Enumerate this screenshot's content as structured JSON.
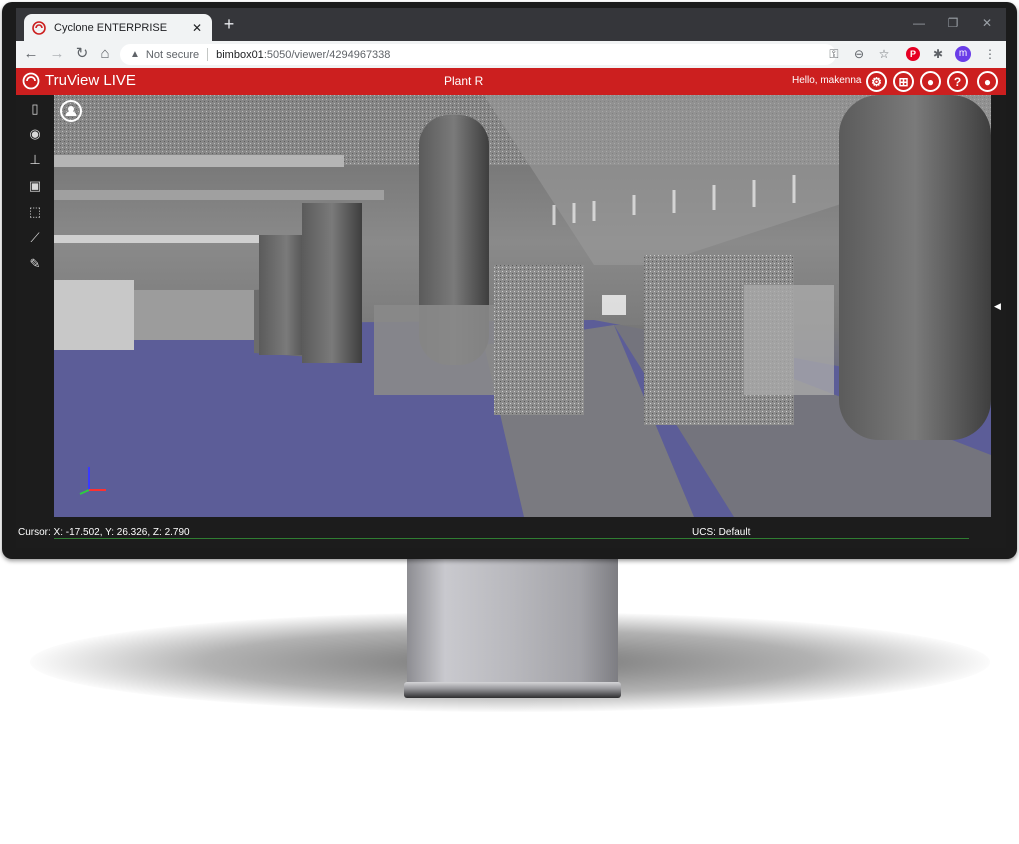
{
  "browser": {
    "tab_title": "Cyclone ENTERPRISE",
    "tab_close": "✕",
    "new_tab": "+",
    "window_controls": [
      "—",
      "❐",
      "✕"
    ],
    "security_label": "Not secure",
    "url_host": "bimbox01",
    "url_path": ":5050/viewer/4294967338",
    "profile_initial": "m"
  },
  "app": {
    "brand": "TruView LIVE",
    "project": "Plant R",
    "greeting": "Hello, makenna",
    "header_icons": [
      "gear-icon",
      "layout-icon",
      "user-settings-icon",
      "help-icon",
      "user-icon"
    ],
    "toolbar_icons": [
      "map-icon",
      "eye-icon",
      "measure-height-icon",
      "cube-section-icon",
      "cube-wireframe-icon",
      "ruler-icon",
      "markup-icon"
    ],
    "brand_color": "#cc1f1f"
  },
  "status": {
    "cursor": "Cursor: X: -17.502, Y: 26.326, Z: 2.790",
    "ucs": "UCS: Default"
  }
}
